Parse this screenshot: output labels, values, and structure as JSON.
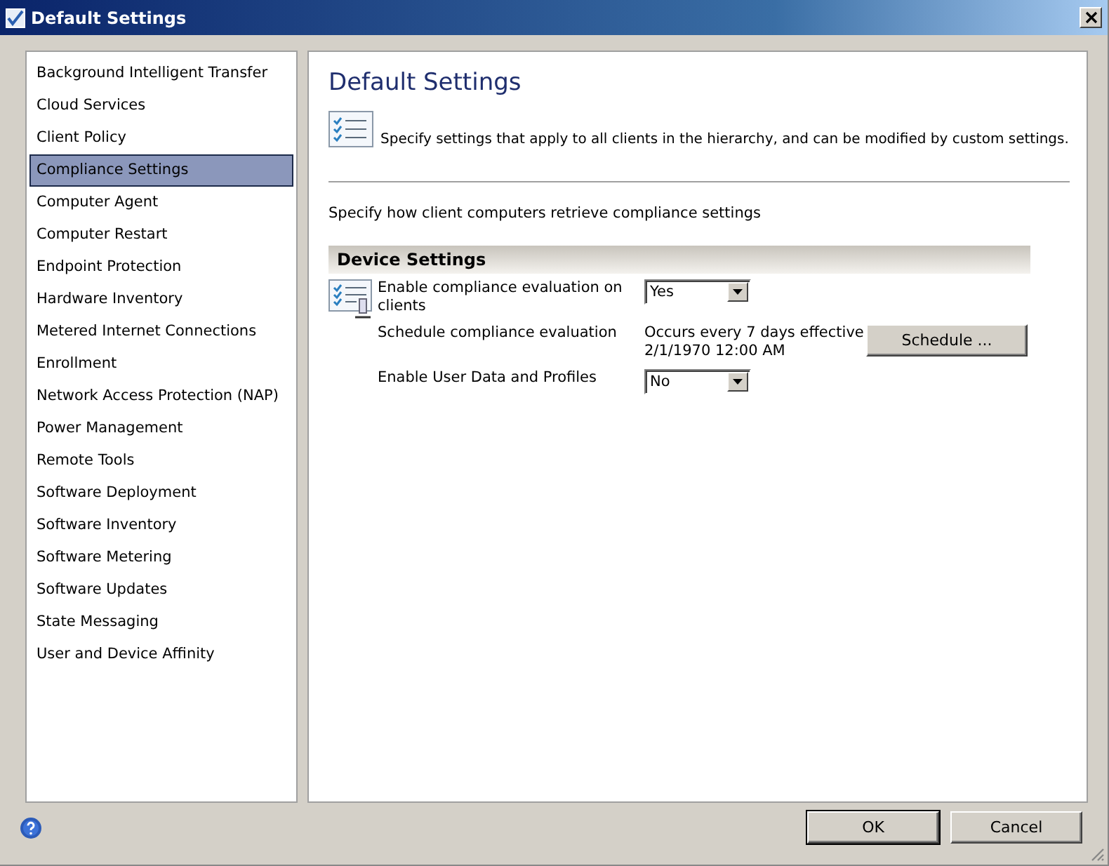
{
  "window": {
    "title": "Default Settings"
  },
  "sidebar": {
    "items": [
      {
        "label": "Background Intelligent Transfer",
        "selected": false
      },
      {
        "label": "Cloud Services",
        "selected": false
      },
      {
        "label": "Client Policy",
        "selected": false
      },
      {
        "label": "Compliance Settings",
        "selected": true
      },
      {
        "label": "Computer Agent",
        "selected": false
      },
      {
        "label": "Computer Restart",
        "selected": false
      },
      {
        "label": "Endpoint Protection",
        "selected": false
      },
      {
        "label": "Hardware Inventory",
        "selected": false
      },
      {
        "label": "Metered Internet Connections",
        "selected": false
      },
      {
        "label": "Enrollment",
        "selected": false
      },
      {
        "label": "Network Access Protection (NAP)",
        "selected": false
      },
      {
        "label": "Power Management",
        "selected": false
      },
      {
        "label": "Remote Tools",
        "selected": false
      },
      {
        "label": "Software Deployment",
        "selected": false
      },
      {
        "label": "Software Inventory",
        "selected": false
      },
      {
        "label": "Software Metering",
        "selected": false
      },
      {
        "label": "Software Updates",
        "selected": false
      },
      {
        "label": "State Messaging",
        "selected": false
      },
      {
        "label": "User and Device Affinity",
        "selected": false
      }
    ]
  },
  "main": {
    "heading": "Default Settings",
    "description": "Specify settings that apply to all clients in the hierarchy, and can be modified by custom settings.",
    "intro": "Specify how client computers retrieve compliance settings",
    "section": "Device Settings",
    "settings": [
      {
        "kind": "dropdown",
        "label": "Enable compliance evaluation on clients",
        "value": "Yes"
      },
      {
        "kind": "schedule",
        "label": "Schedule compliance evaluation",
        "value": "Occurs every 7 days effective 2/1/1970 12:00 AM",
        "button": "Schedule ..."
      },
      {
        "kind": "dropdown",
        "label": "Enable User Data and Profiles",
        "value": "No"
      }
    ]
  },
  "buttons": [
    "OK",
    "Cancel"
  ]
}
